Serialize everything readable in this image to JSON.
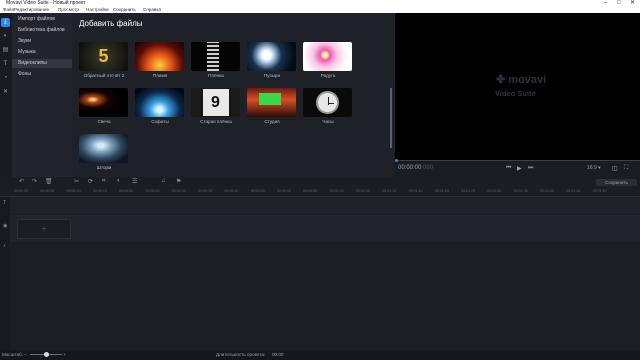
{
  "window": {
    "title": "Movavi Video Suite - Новый проект"
  },
  "menu": [
    "Файл",
    "Редактирование",
    "Просмотр",
    "Настройки",
    "Сохранить",
    "Справка"
  ],
  "ribbon": [
    {
      "name": "import-icon",
      "glyph": "⤓"
    },
    {
      "name": "filters-icon",
      "glyph": "◐"
    },
    {
      "name": "transitions-icon",
      "glyph": "▤"
    },
    {
      "name": "titles-icon",
      "glyph": "T"
    },
    {
      "name": "stickers-icon",
      "glyph": "◔"
    },
    {
      "name": "tools-icon",
      "glyph": "✕"
    }
  ],
  "categories": [
    {
      "label": "Импорт файлов",
      "active": false
    },
    {
      "label": "Библиотека файлов",
      "active": false
    },
    {
      "label": "Звуки",
      "active": false
    },
    {
      "label": "Музыка",
      "active": false
    },
    {
      "label": "Видеоклипы",
      "active": true
    },
    {
      "label": "Фоны",
      "active": false
    }
  ],
  "media": {
    "heading": "Добавить файлы",
    "clips": [
      {
        "label": "Обратный отсчёт 2",
        "art": "countdown",
        "digit": "5"
      },
      {
        "label": "Пламя",
        "art": "flame"
      },
      {
        "label": "Плёнка",
        "art": "film"
      },
      {
        "label": "Пузыри",
        "art": "bubbles"
      },
      {
        "label": "Радуга",
        "art": "flower"
      },
      {
        "label": "Свеча",
        "art": "candle"
      },
      {
        "label": "Софиты",
        "art": "spotlights"
      },
      {
        "label": "Старая плёнка",
        "art": "oldfilm",
        "digit": "9"
      },
      {
        "label": "Студия",
        "art": "studio"
      },
      {
        "label": "Часы",
        "art": "clock"
      },
      {
        "label": "Шторм",
        "art": "storm"
      }
    ]
  },
  "preview": {
    "brand": "movavi",
    "product": "Video Suite",
    "timecode": "00:00:00",
    "timecode_ms": ".000",
    "aspect": "16:9"
  },
  "timeline": {
    "export_label": "Сохранить",
    "ruler": [
      "00:00:00",
      "00:00:05",
      "00:00:10",
      "00:00:15",
      "00:00:20",
      "00:00:25",
      "00:00:30",
      "00:00:35",
      "00:00:40",
      "00:00:45",
      "00:00:50",
      "00:00:55",
      "00:01:00",
      "00:01:05",
      "00:01:10",
      "00:01:15",
      "00:01:20",
      "00:01:25",
      "00:01:30",
      "00:01:35",
      "00:01:40",
      "00:01:45",
      "00:01:50"
    ],
    "add_label": "+"
  },
  "status": {
    "scale_label": "Масштаб:",
    "duration_label": "Длительность проекта:",
    "duration_value": "00:00",
    "zoom": 0.5
  }
}
